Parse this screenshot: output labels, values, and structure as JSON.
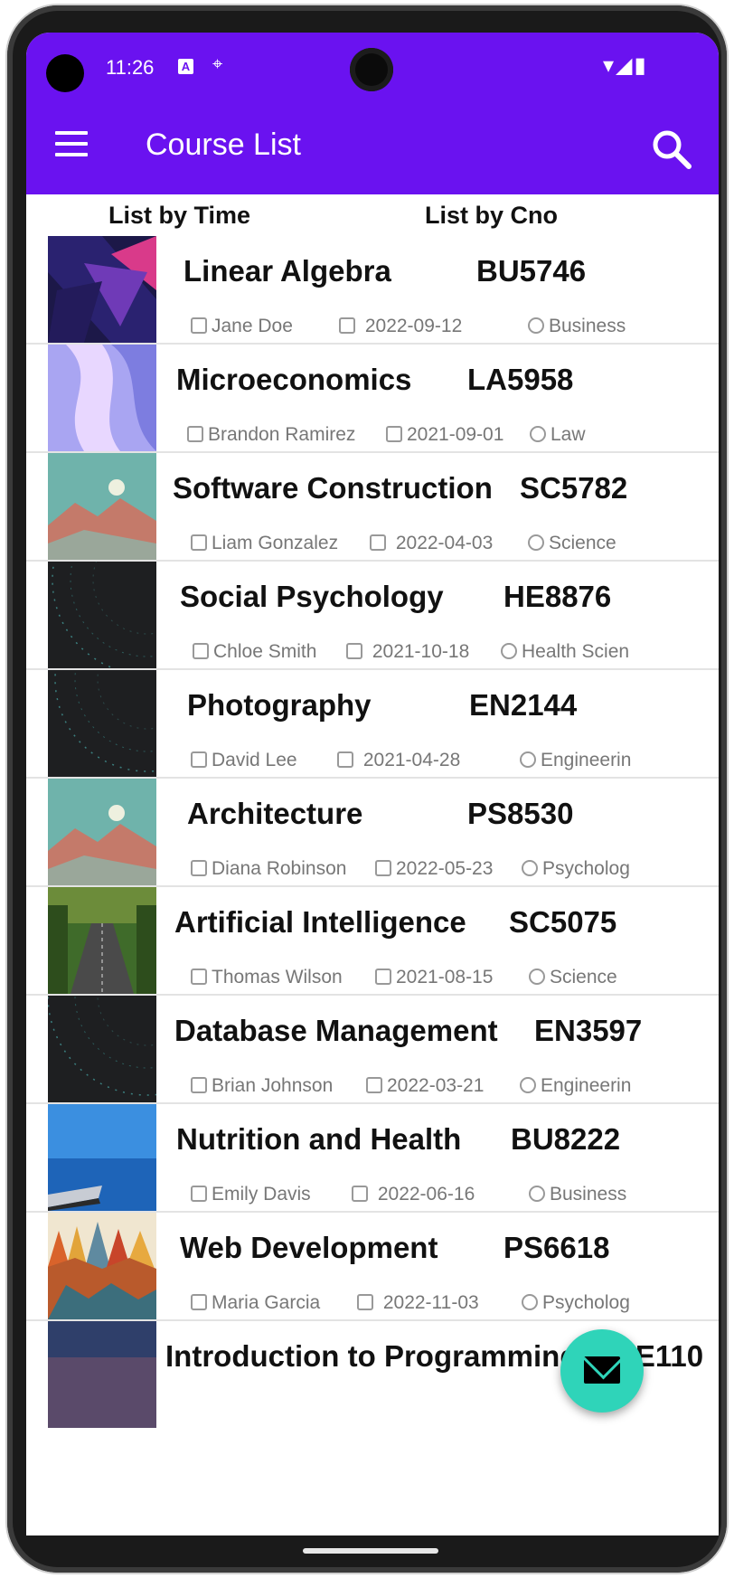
{
  "status": {
    "time": "11:26",
    "sys_icons": "▾◢▮",
    "a_badge": "A",
    "loc_icon": "⌖"
  },
  "appbar": {
    "title": "Course List"
  },
  "tabs": [
    {
      "label": "List by Time"
    },
    {
      "label": "List by Cno"
    }
  ],
  "courses": [
    {
      "name": "Linear Algebra",
      "code": "BU5746",
      "teacher": "Jane Doe",
      "date": "2022-09-12",
      "dept": "Business"
    },
    {
      "name": "Microeconomics",
      "code": "LA5958",
      "teacher": "Brandon Ramirez",
      "date": "2021-09-01",
      "dept": "Law"
    },
    {
      "name": "Software Construction",
      "code": "SC5782",
      "teacher": "Liam Gonzalez",
      "date": "2022-04-03",
      "dept": "Science"
    },
    {
      "name": "Social Psychology",
      "code": "HE8876",
      "teacher": "Chloe Smith",
      "date": "2021-10-18",
      "dept": "Health Scien"
    },
    {
      "name": "Photography",
      "code": "EN2144",
      "teacher": "David Lee",
      "date": "2021-04-28",
      "dept": "Engineerin"
    },
    {
      "name": "Architecture",
      "code": "PS8530",
      "teacher": "Diana Robinson",
      "date": "2022-05-23",
      "dept": "Psycholog"
    },
    {
      "name": "Artificial Intelligence",
      "code": "SC5075",
      "teacher": "Thomas Wilson",
      "date": "2021-08-15",
      "dept": "Science"
    },
    {
      "name": "Database Management",
      "code": "EN3597",
      "teacher": "Brian Johnson",
      "date": "2022-03-21",
      "dept": "Engineerin"
    },
    {
      "name": "Nutrition and Health",
      "code": "BU8222",
      "teacher": "Emily Davis",
      "date": "2022-06-16",
      "dept": "Business"
    },
    {
      "name": "Web Development",
      "code": "PS6618",
      "teacher": "Maria Garcia",
      "date": "2022-11-03",
      "dept": "Psycholog"
    },
    {
      "name": "Introduction to Programming",
      "code": "HE110",
      "teacher": "",
      "date": "",
      "dept": ""
    }
  ],
  "fab": {
    "icon": "email-icon"
  }
}
